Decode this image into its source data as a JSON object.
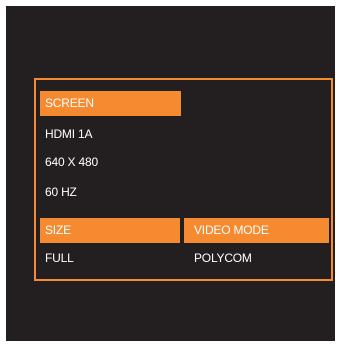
{
  "menu": {
    "screen_header": "SCREEN",
    "input": "HDMI 1A",
    "resolution": "640 X 480",
    "refresh_rate": "60 HZ",
    "size_header": "SIZE",
    "size_value": "FULL",
    "video_mode_header": "VIDEO MODE",
    "video_mode_value": "POLYCOM"
  },
  "colors": {
    "accent": "#f58a31",
    "background": "#231f20",
    "text": "#ffffff"
  }
}
